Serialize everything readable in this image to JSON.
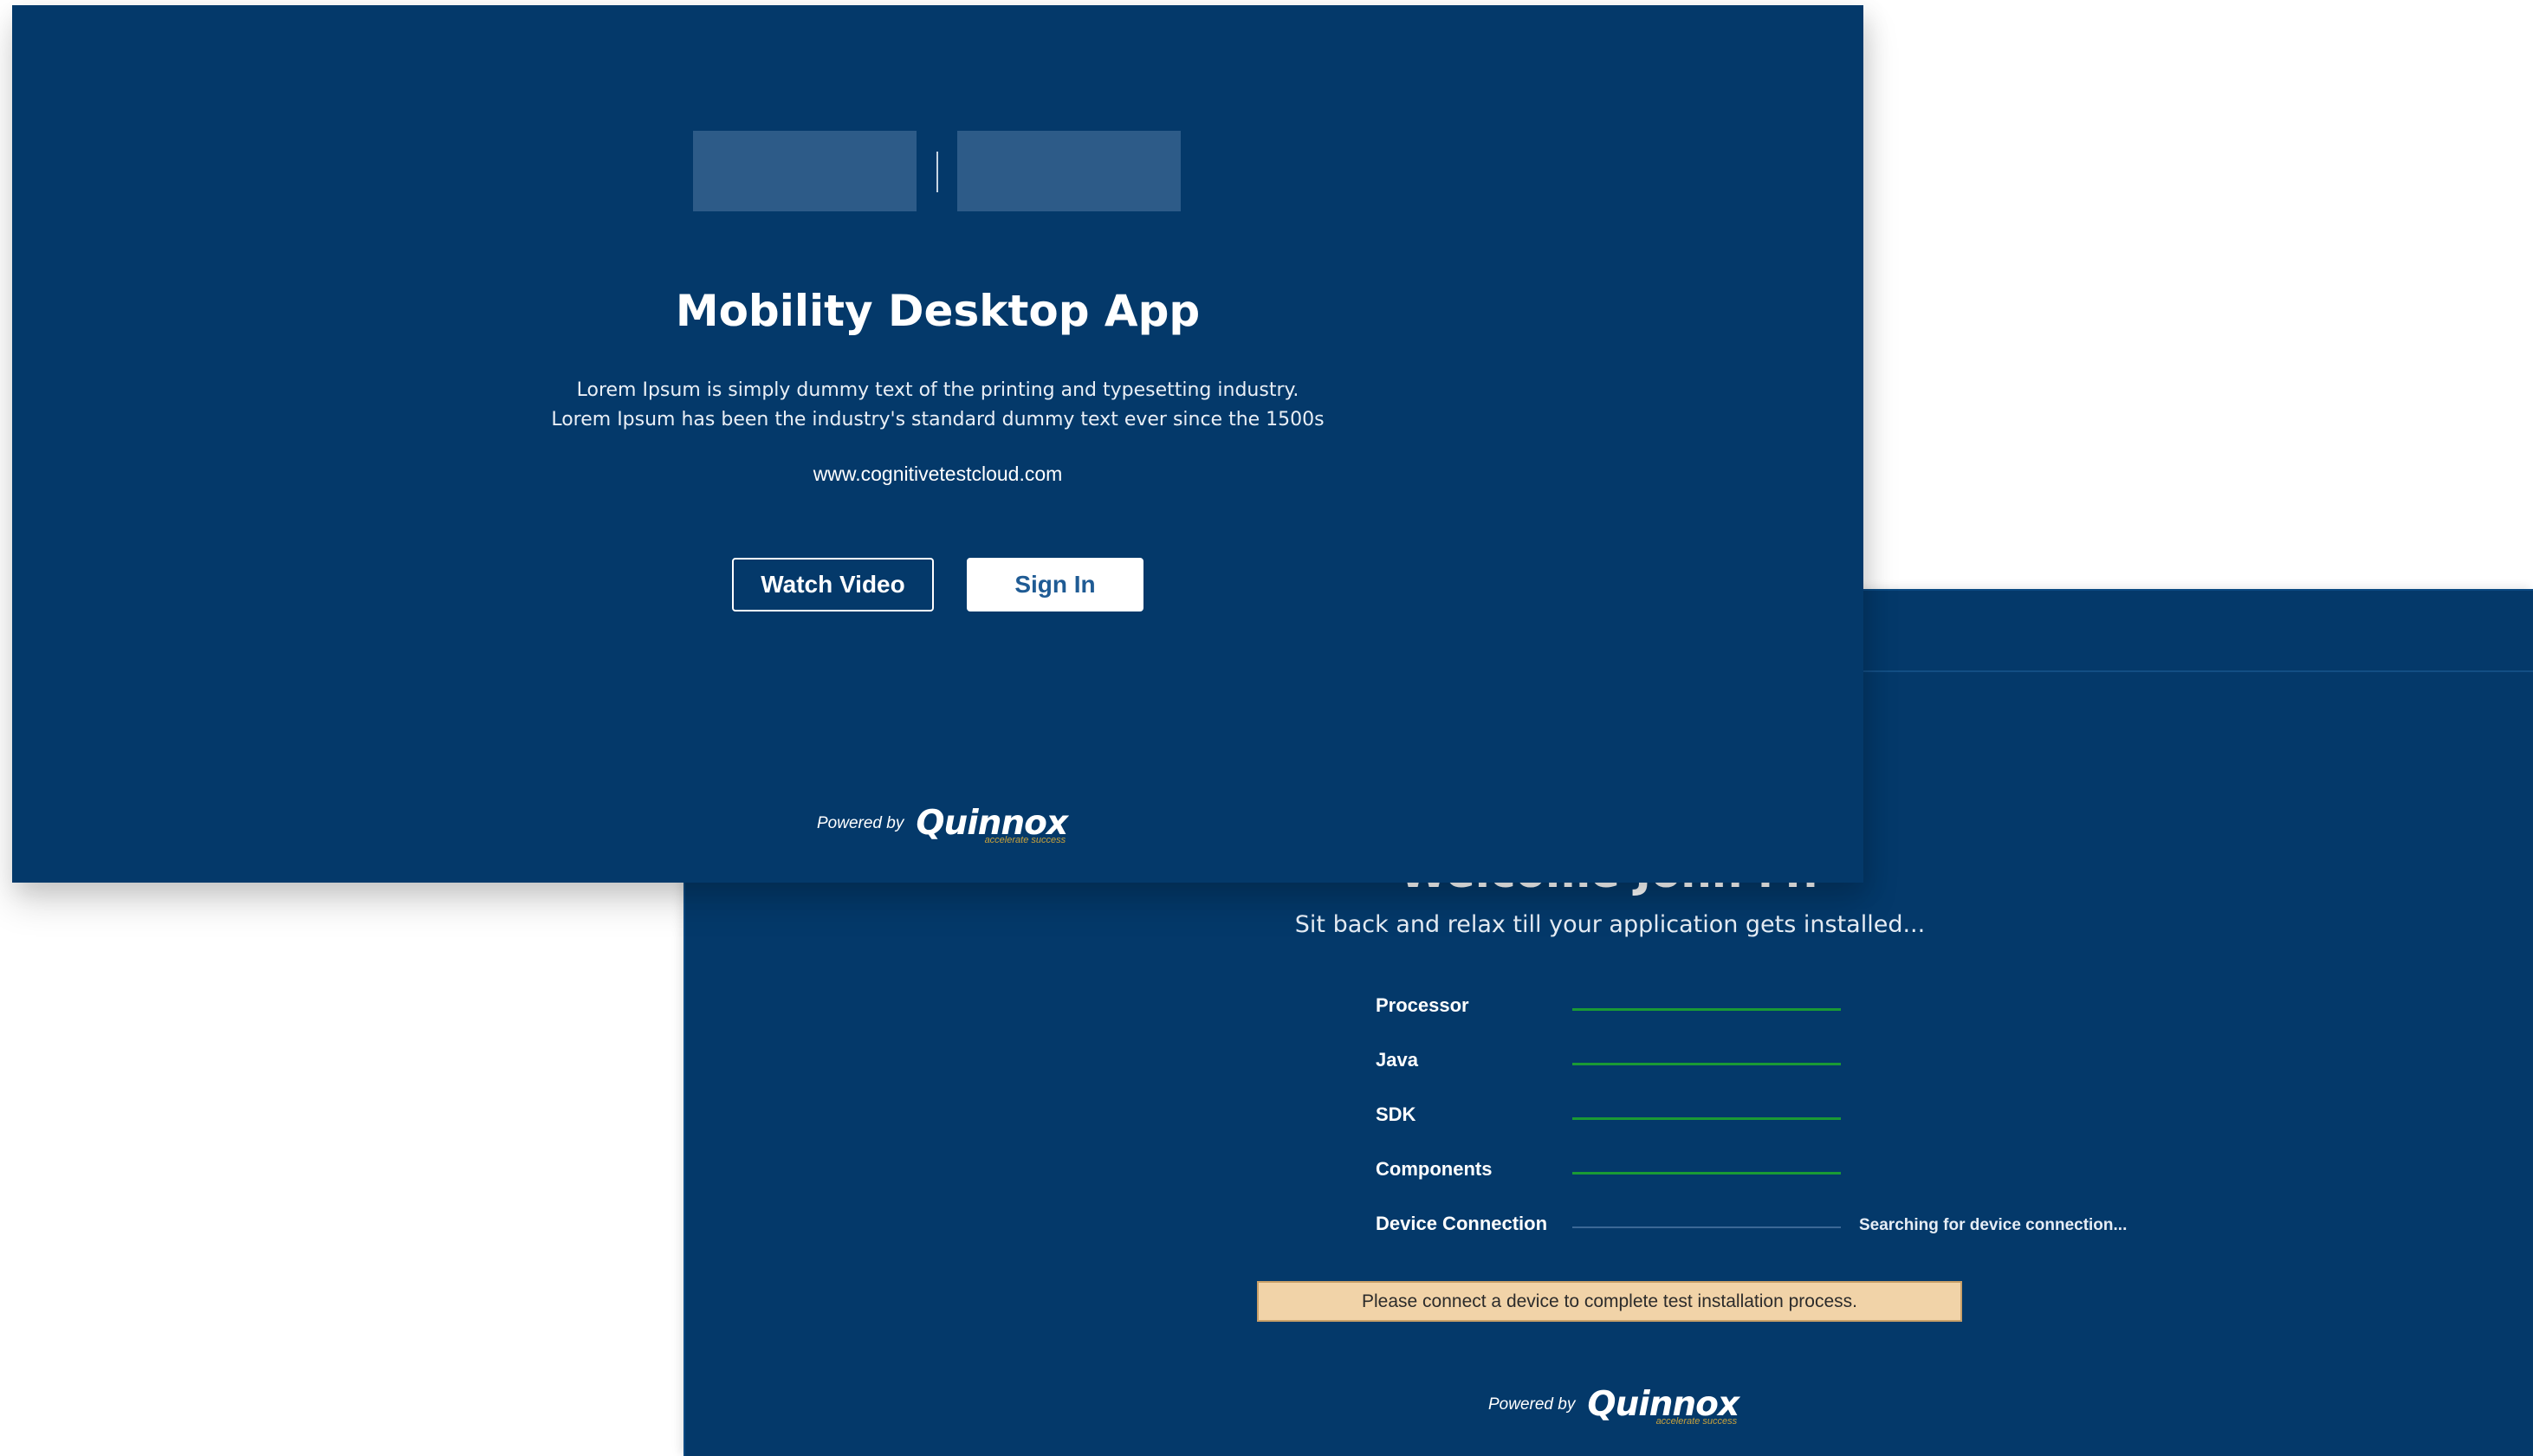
{
  "install_screen": {
    "welcome_title": "Welcome John M!",
    "subtitle": "Sit back and relax till your application gets installed...",
    "requirements": [
      {
        "label": "Processor",
        "status": "",
        "complete": true
      },
      {
        "label": "Java",
        "status": "",
        "complete": true
      },
      {
        "label": "SDK",
        "status": "",
        "complete": true
      },
      {
        "label": "Components",
        "status": "",
        "complete": true
      },
      {
        "label": "Device Connection",
        "status": "Searching for device connection...",
        "complete": false
      }
    ],
    "notice": "Please connect a device to complete test installation process.",
    "powered_by": "Powered by",
    "brand_name": "Quinnox",
    "brand_tagline": "accelerate success"
  },
  "welcome_screen": {
    "app_title": "Mobility Desktop App",
    "description_line1": "Lorem Ipsum is simply dummy text of the printing and typesetting industry.",
    "description_line2": "Lorem Ipsum has been the industry's standard dummy text ever since the 1500s",
    "website": "www.cognitivetestcloud.com",
    "watch_video_label": "Watch Video",
    "sign_in_label": "Sign In",
    "powered_by": "Powered by",
    "brand_name": "Quinnox",
    "brand_tagline": "accelerate success"
  },
  "colors": {
    "background": "#04396a",
    "progress_complete": "#1a9a35",
    "notice_background": "#f1d3a8",
    "sign_in_text": "#1f5b94"
  }
}
